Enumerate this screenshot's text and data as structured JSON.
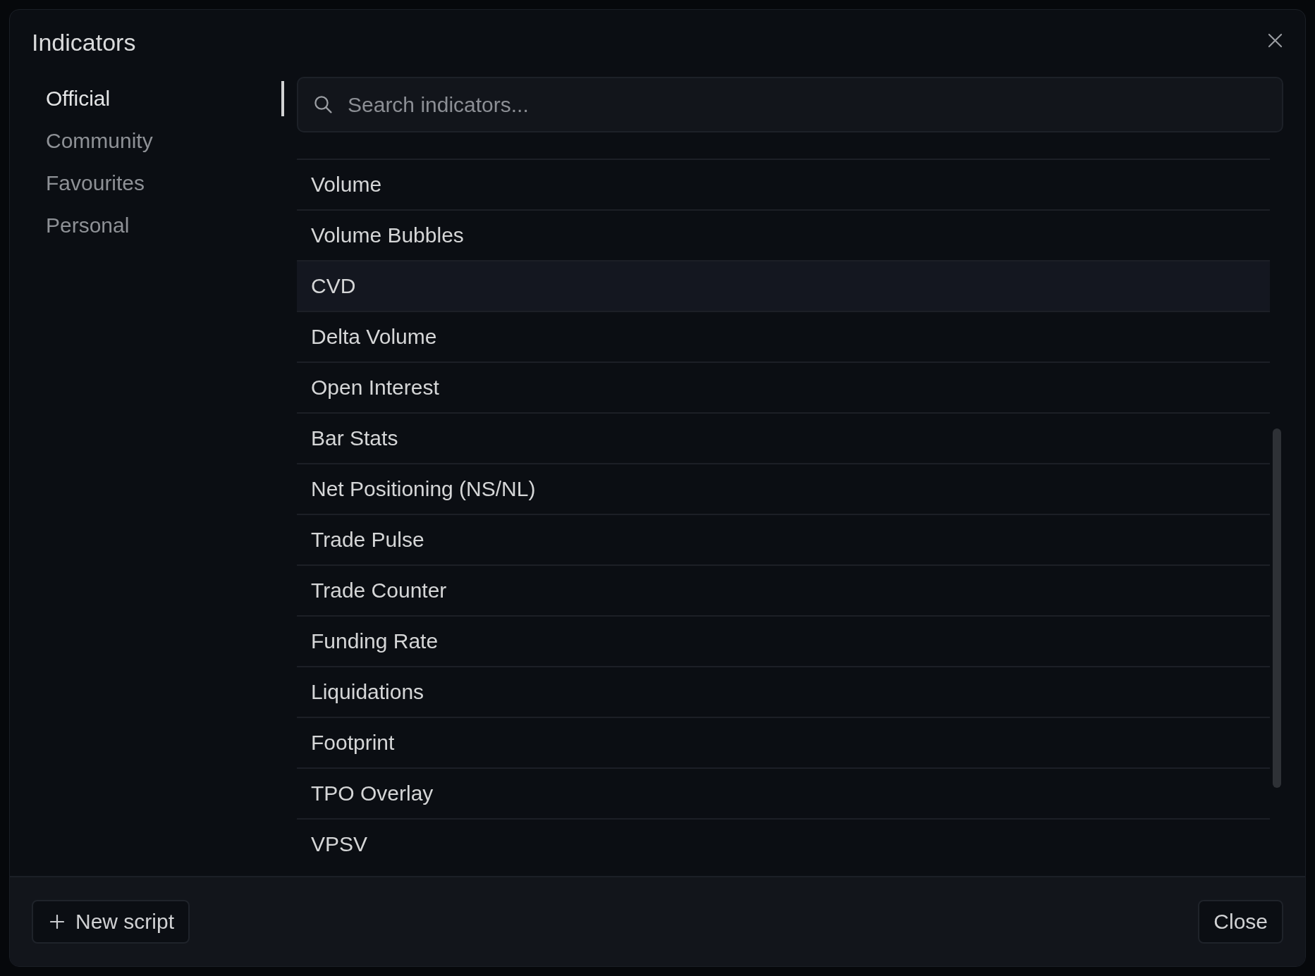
{
  "dialog": {
    "title": "Indicators"
  },
  "categories": [
    {
      "label": "Official",
      "selected": true
    },
    {
      "label": "Community",
      "selected": false
    },
    {
      "label": "Favourites",
      "selected": false
    },
    {
      "label": "Personal",
      "selected": false
    }
  ],
  "search": {
    "placeholder": "Search indicators..."
  },
  "indicators": [
    {
      "name": "Volume",
      "selected": false
    },
    {
      "name": "Volume Bubbles",
      "selected": false
    },
    {
      "name": "CVD",
      "selected": true
    },
    {
      "name": "Delta Volume",
      "selected": false
    },
    {
      "name": "Open Interest",
      "selected": false
    },
    {
      "name": "Bar Stats",
      "selected": false
    },
    {
      "name": "Net Positioning (NS/NL)",
      "selected": false
    },
    {
      "name": "Trade Pulse",
      "selected": false
    },
    {
      "name": "Trade Counter",
      "selected": false
    },
    {
      "name": "Funding Rate",
      "selected": false
    },
    {
      "name": "Liquidations",
      "selected": false
    },
    {
      "name": "Footprint",
      "selected": false
    },
    {
      "name": "TPO Overlay",
      "selected": false
    },
    {
      "name": "VPSV",
      "selected": false
    }
  ],
  "footer": {
    "buttons": [
      {
        "kind": "add",
        "label": "New script"
      },
      {
        "kind": "close",
        "label": "Close"
      }
    ]
  }
}
